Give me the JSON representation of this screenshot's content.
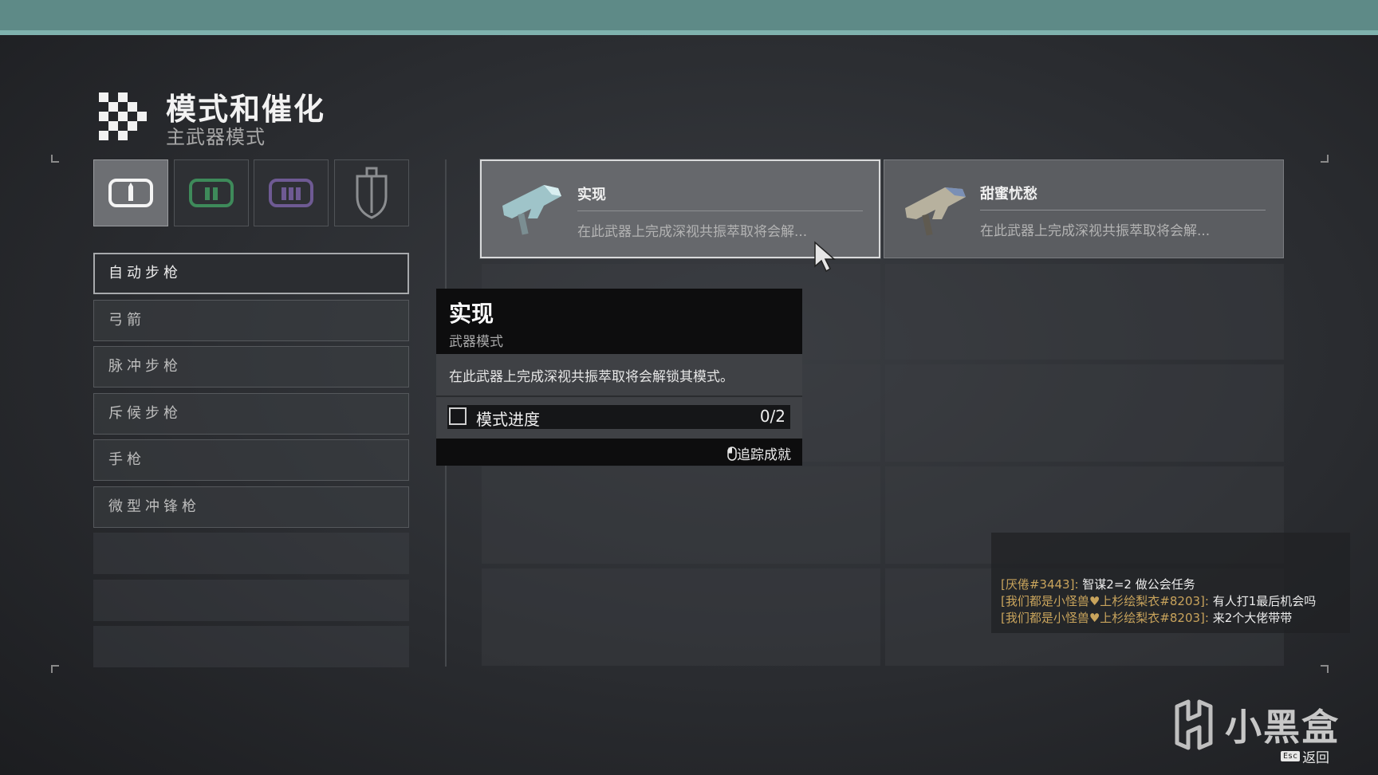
{
  "header": {
    "title": "模式和催化",
    "subtitle": "主武器模式"
  },
  "slot_tabs": [
    {
      "icon": "kinetic-ammo-icon",
      "active": true
    },
    {
      "icon": "special-ammo-icon",
      "active": false
    },
    {
      "icon": "heavy-ammo-icon",
      "active": false
    },
    {
      "icon": "ghost-shell-icon",
      "active": false
    }
  ],
  "categories": [
    {
      "label": "自动步枪",
      "active": true
    },
    {
      "label": "弓箭",
      "active": false
    },
    {
      "label": "脉冲步枪",
      "active": false
    },
    {
      "label": "斥候步枪",
      "active": false
    },
    {
      "label": "手枪",
      "active": false
    },
    {
      "label": "微型冲锋枪",
      "active": false
    }
  ],
  "mods": [
    {
      "name": "实现",
      "desc": "在此武器上完成深视共振萃取将会解...",
      "selected": true
    },
    {
      "name": "甜蜜忧愁",
      "desc": "在此武器上完成深视共振萃取将会解...",
      "selected": false
    }
  ],
  "tooltip": {
    "title": "实现",
    "type": "武器模式",
    "desc": "在此武器上完成深视共振萃取将会解锁其模式。",
    "progress_label": "模式进度",
    "progress_value": "0/2",
    "progress_fraction": 0,
    "track_label": "追踪成就"
  },
  "chat": [
    {
      "name": "[厌倦#3443]:",
      "msg": " 智谋2=2 做公会任务"
    },
    {
      "name": "[我们都是小怪兽♥上杉绘梨衣#8203]:",
      "msg": " 有人打1最后机会吗"
    },
    {
      "name": "[我们都是小怪兽♥上杉绘梨衣#8203]:",
      "msg": " 来2个大佬带带"
    }
  ],
  "watermark": {
    "text": "小黑盒"
  },
  "back": {
    "key": "Esc",
    "label": "返回"
  },
  "colors": {
    "topbar": "#5e8a87",
    "accent_line": "#7fb2ae",
    "chat_name": "#c9a45c"
  }
}
